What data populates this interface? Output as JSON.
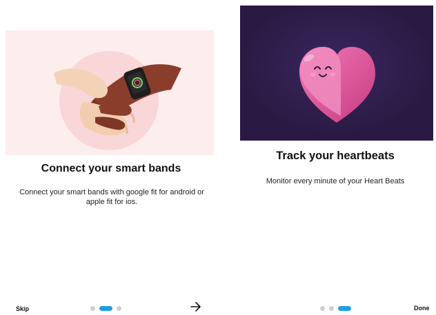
{
  "screens": [
    {
      "title": "Connect your smart bands",
      "description": "Connect your smart bands with google fit for android or apple fit for ios.",
      "illustration": "handshake-smartwatch-illustration",
      "pagination": {
        "total": 3,
        "active": 2
      },
      "skip_label": "Skip",
      "next_icon": "arrow-right-icon"
    },
    {
      "title": "Track your heartbeats",
      "description": "Monitor every minute of your Heart Beats",
      "illustration": "smiling-heart-illustration",
      "pagination": {
        "total": 3,
        "active": 3
      },
      "done_label": "Done"
    }
  ],
  "colors": {
    "accent": "#1e9fe0",
    "dot_inactive": "#cfcfcf",
    "illustration_bg_1": "#fdeeee",
    "illustration_bg_2": "#2a1a43",
    "heart": "#e0559a"
  }
}
